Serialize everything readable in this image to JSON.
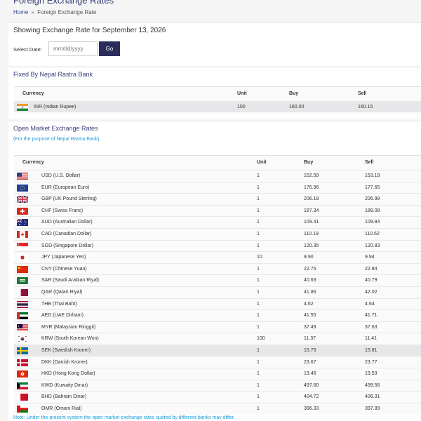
{
  "header": {
    "title": "Foreign Exchange Rates",
    "breadcrumb_home": "Home",
    "breadcrumb_sep": "»",
    "breadcrumb_current": "Foreign Exchange Rate"
  },
  "date_section": {
    "showing": "Showing Exchange Rate for September 13, 2026",
    "label": "Select Date:",
    "placeholder": "mm/dd/yyyy",
    "go": "Go"
  },
  "fixed": {
    "title": "Fixed By Nepal Rastra Bank",
    "headers": {
      "currency": "Currency",
      "unit": "Unit",
      "buy": "Buy",
      "sell": "Sell"
    },
    "rows": [
      {
        "flag": "india-flag-icon",
        "currency": "INR (Indian Rupee)",
        "unit": "100",
        "buy": "160.00",
        "sell": "160.15"
      }
    ]
  },
  "open": {
    "title": "Open Market Exchange Rates",
    "subtitle": "(For the purpose of Nepal Rastra Bank)",
    "headers": {
      "currency": "Currency",
      "unit": "Unit",
      "buy": "Buy",
      "sell": "Sell"
    },
    "rows": [
      {
        "flag": "usa-flag-icon",
        "currency": "USD (U.S. Dollar)",
        "unit": "1",
        "buy": "152.59",
        "sell": "153.19"
      },
      {
        "flag": "eu-flag-icon",
        "currency": "EUR (European Euro)",
        "unit": "1",
        "buy": "176.96",
        "sell": "177.65"
      },
      {
        "flag": "uk-flag-icon",
        "currency": "GBP (UK Pound Sterling)",
        "unit": "1",
        "buy": "206.18",
        "sell": "206.99"
      },
      {
        "flag": "switzerland-flag-icon",
        "currency": "CHF (Swiss Franc)",
        "unit": "1",
        "buy": "187.34",
        "sell": "188.08"
      },
      {
        "flag": "australia-flag-icon",
        "currency": "AUD (Australian Dollar)",
        "unit": "1",
        "buy": "109.41",
        "sell": "109.84"
      },
      {
        "flag": "canada-flag-icon",
        "currency": "CAD (Canadian Dollar)",
        "unit": "1",
        "buy": "110.19",
        "sell": "110.62"
      },
      {
        "flag": "singapore-flag-icon",
        "currency": "SGD (Singapore Dollar)",
        "unit": "1",
        "buy": "120.35",
        "sell": "120.83"
      },
      {
        "flag": "japan-flag-icon",
        "currency": "JPY (Japanese Yen)",
        "unit": "10",
        "buy": "9.90",
        "sell": "9.94"
      },
      {
        "flag": "china-flag-icon",
        "currency": "CNY (Chinese Yuan)",
        "unit": "1",
        "buy": "22.75",
        "sell": "22.84"
      },
      {
        "flag": "saudi-flag-icon",
        "currency": "SAR (Saudi Arabian Riyal)",
        "unit": "1",
        "buy": "40.63",
        "sell": "40.79"
      },
      {
        "flag": "qatar-flag-icon",
        "currency": "QAR (Qatari Riyal)",
        "unit": "1",
        "buy": "41.86",
        "sell": "42.02"
      },
      {
        "flag": "thailand-flag-icon",
        "currency": "THB (Thai Baht)",
        "unit": "1",
        "buy": "4.62",
        "sell": "4.64"
      },
      {
        "flag": "uae-flag-icon",
        "currency": "AED (UAE Dirham)",
        "unit": "1",
        "buy": "41.55",
        "sell": "41.71"
      },
      {
        "flag": "malaysia-flag-icon",
        "currency": "MYR (Malaysian Ringgit)",
        "unit": "1",
        "buy": "37.49",
        "sell": "37.63"
      },
      {
        "flag": "korea-flag-icon",
        "currency": "KRW (South Korean Won)",
        "unit": "100",
        "buy": "11.37",
        "sell": "11.41"
      },
      {
        "flag": "sweden-flag-icon",
        "currency": "SEK (Swedish Kroner)",
        "unit": "1",
        "buy": "15.75",
        "sell": "15.81"
      },
      {
        "flag": "denmark-flag-icon",
        "currency": "DKK (Danish Kroner)",
        "unit": "1",
        "buy": "23.67",
        "sell": "23.77"
      },
      {
        "flag": "hongkong-flag-icon",
        "currency": "HKD (Hong Kong Dollar)",
        "unit": "1",
        "buy": "19.46",
        "sell": "19.53"
      },
      {
        "flag": "kuwait-flag-icon",
        "currency": "KWD (Kuwaity Dinar)",
        "unit": "1",
        "buy": "497.60",
        "sell": "499.56"
      },
      {
        "flag": "bahrain-flag-icon",
        "currency": "BHD (Bahrain Dinar)",
        "unit": "1",
        "buy": "404.72",
        "sell": "406.31"
      },
      {
        "flag": "oman-flag-icon",
        "currency": "OMR (Omani Rial)",
        "unit": "1",
        "buy": "396.33",
        "sell": "397.89"
      }
    ]
  },
  "note": "Note: Under the present system the open market exchange rates quoted by different banks may differ."
}
